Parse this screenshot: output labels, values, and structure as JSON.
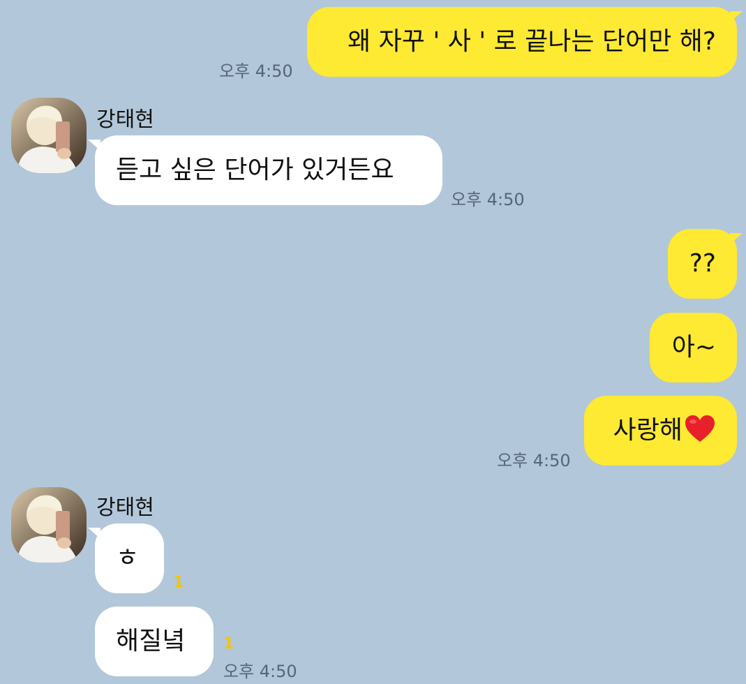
{
  "colors": {
    "background": "#b2c7d9",
    "my_bubble": "#fee933",
    "other_bubble": "#ffffff",
    "unread": "#f5c400"
  },
  "messages": [
    {
      "sender": "me",
      "text": "왜 자꾸 ' 사 ' 로 끝나는 단어만 해?",
      "time": "오후 4:50"
    },
    {
      "sender": "other",
      "name": "강태현",
      "text": "듣고 싶은 단어가 있거든요",
      "time": "오후 4:50"
    },
    {
      "sender": "me",
      "text": "??"
    },
    {
      "sender": "me",
      "text": "아~"
    },
    {
      "sender": "me",
      "text": "사랑해",
      "emoji": "heart-emoji",
      "time": "오후 4:50"
    },
    {
      "sender": "other",
      "name": "강태현",
      "text": "ㅎ",
      "unread": "1"
    },
    {
      "sender": "other",
      "text": "해질녘",
      "unread": "1",
      "time": "오후 4:50"
    }
  ]
}
